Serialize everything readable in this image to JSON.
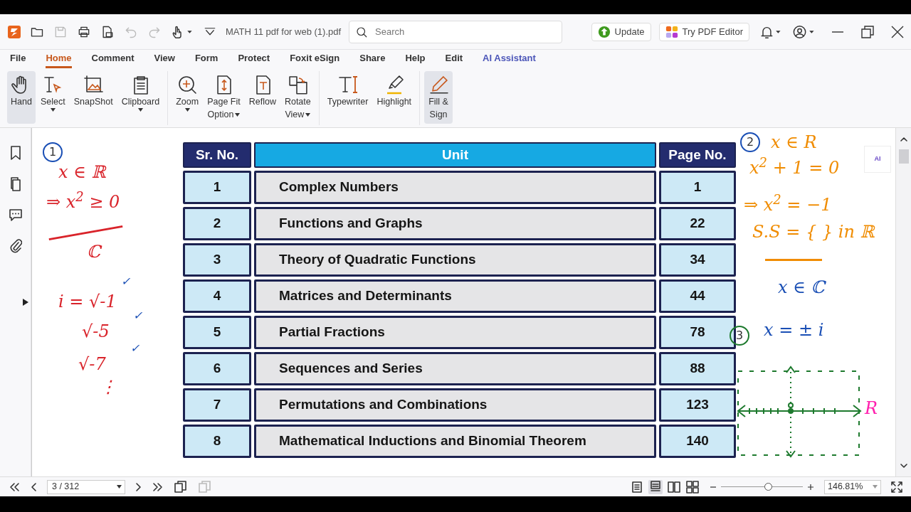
{
  "title_bar": {
    "file_name": "MATH 11 pdf for web (1).pdf",
    "search": {
      "placeholder": "Search"
    },
    "quick_tools": [
      {
        "kind": "open",
        "disabled": false
      },
      {
        "kind": "save",
        "disabled": true
      },
      {
        "kind": "print",
        "disabled": false
      },
      {
        "kind": "export",
        "disabled": false
      },
      {
        "kind": "undo",
        "disabled": true
      },
      {
        "kind": "redo",
        "disabled": true
      }
    ],
    "buttons": [
      {
        "label": "Update",
        "kind": "update"
      },
      {
        "label": "Try PDF Editor",
        "kind": "editor"
      }
    ]
  },
  "menu_tabs": [
    {
      "label": "File",
      "selected": false,
      "kind": "plain"
    },
    {
      "label": "Home",
      "selected": true,
      "kind": "plain"
    },
    {
      "label": "Comment",
      "selected": false,
      "kind": "plain"
    },
    {
      "label": "View",
      "selected": false,
      "kind": "plain"
    },
    {
      "label": "Form",
      "selected": false,
      "kind": "plain"
    },
    {
      "label": "Protect",
      "selected": false,
      "kind": "plain"
    },
    {
      "label": "Foxit eSign",
      "selected": false,
      "kind": "plain"
    },
    {
      "label": "Share",
      "selected": false,
      "kind": "plain"
    },
    {
      "label": "Help",
      "selected": false,
      "kind": "plain"
    },
    {
      "label": "Edit",
      "selected": false,
      "kind": "plain"
    },
    {
      "label": "AI Assistant",
      "selected": false,
      "kind": "ai"
    }
  ],
  "ribbon_groups": [
    {
      "tools": [
        {
          "label": "Hand",
          "kind": "hand",
          "selected": true,
          "dropdown": false
        },
        {
          "label": "Select",
          "kind": "select",
          "selected": false,
          "dropdown": true
        },
        {
          "label": "SnapShot",
          "kind": "snapshot",
          "selected": false,
          "dropdown": false
        },
        {
          "label": "Clipboard",
          "kind": "clipboard",
          "selected": false,
          "dropdown": true
        }
      ]
    },
    {
      "tools": [
        {
          "label": "Zoom",
          "kind": "zoom",
          "selected": false,
          "dropdown": true
        },
        {
          "label": "Page Fit\nOption",
          "kind": "pagefit",
          "selected": false,
          "dropdown": true
        },
        {
          "label": "Reflow",
          "kind": "reflow",
          "selected": false,
          "dropdown": false
        },
        {
          "label": "Rotate\nView",
          "kind": "rotate",
          "selected": false,
          "dropdown": true
        }
      ]
    },
    {
      "tools": [
        {
          "label": "Typewriter",
          "kind": "typewriter",
          "selected": false,
          "dropdown": false
        },
        {
          "label": "Highlight",
          "kind": "highlight",
          "selected": false,
          "dropdown": false
        }
      ]
    },
    {
      "tools": [
        {
          "label": "Fill &\nSign",
          "kind": "fillsign",
          "selected": true,
          "dropdown": false
        }
      ]
    }
  ],
  "document": {
    "table": {
      "columns": [
        "Sr. No.",
        "Unit",
        "Page No."
      ],
      "rows": [
        [
          "1",
          "Complex Numbers",
          "1"
        ],
        [
          "2",
          "Functions and Graphs",
          "22"
        ],
        [
          "3",
          "Theory of Quadratic Functions",
          "34"
        ],
        [
          "4",
          "Matrices and Determinants",
          "44"
        ],
        [
          "5",
          "Partial Fractions",
          "78"
        ],
        [
          "6",
          "Sequences and Series",
          "88"
        ],
        [
          "7",
          "Permutations and Combinations",
          "123"
        ],
        [
          "8",
          "Mathematical Inductions and Binomial Theorem",
          "140"
        ]
      ]
    },
    "notes": [
      {
        "kind": "circled",
        "text": "1",
        "color": "#1a4fb5"
      },
      {
        "kind": "text",
        "text": "x ∈ ℝ",
        "color": "#d9232a"
      },
      {
        "kind": "text",
        "text": "⇒ x$^{2}$ ≥ 0",
        "color": "#d9232a"
      },
      {
        "kind": "rule",
        "color": "#d9232a"
      },
      {
        "kind": "text",
        "text": "ℂ",
        "color": "#d9232a"
      },
      {
        "kind": "check",
        "text": "✓",
        "color": "#1a4fb5"
      },
      {
        "kind": "text",
        "text": "i = √-1",
        "color": "#d9232a"
      },
      {
        "kind": "check",
        "text": "✓",
        "color": "#1a4fb5"
      },
      {
        "kind": "text",
        "text": "√-5",
        "color": "#d9232a"
      },
      {
        "kind": "check",
        "text": "✓",
        "color": "#1a4fb5"
      },
      {
        "kind": "text",
        "text": "√-7",
        "color": "#d9232a"
      },
      {
        "kind": "text",
        "text": "⋮",
        "color": "#d9232a"
      },
      {
        "kind": "circled",
        "text": "2",
        "color": "#1a4fb5"
      },
      {
        "kind": "text",
        "text": "x ∈ R",
        "color": "#f08c00"
      },
      {
        "kind": "text",
        "text": "x$^{2}$ + 1 = 0",
        "color": "#f08c00"
      },
      {
        "kind": "text",
        "text": "⇒ x$^{2}$ = −1",
        "color": "#f08c00"
      },
      {
        "kind": "text",
        "text": "S.S = { } in ℝ",
        "color": "#f08c00"
      },
      {
        "kind": "rule",
        "color": "#f08c00"
      },
      {
        "kind": "text",
        "text": "x ∈ ℂ",
        "color": "#1a4fb5"
      },
      {
        "kind": "circled",
        "text": "3",
        "color": "#1e7a2e"
      },
      {
        "kind": "text",
        "text": "x = ± i",
        "color": "#1a4fb5"
      },
      {
        "kind": "axis",
        "color": "#1e7a2e"
      },
      {
        "kind": "text",
        "text": "R",
        "color": "#ff1fae"
      }
    ]
  },
  "ai_button": {
    "label": "AI"
  },
  "status_bar": {
    "page": "3 / 312",
    "view_modes": [
      {
        "kind": "single",
        "selected": false
      },
      {
        "kind": "continuous",
        "selected": true
      },
      {
        "kind": "facing",
        "selected": false
      },
      {
        "kind": "cont-facing",
        "selected": false
      }
    ],
    "zoom": {
      "level": 0.57,
      "value": "146.81%"
    }
  }
}
